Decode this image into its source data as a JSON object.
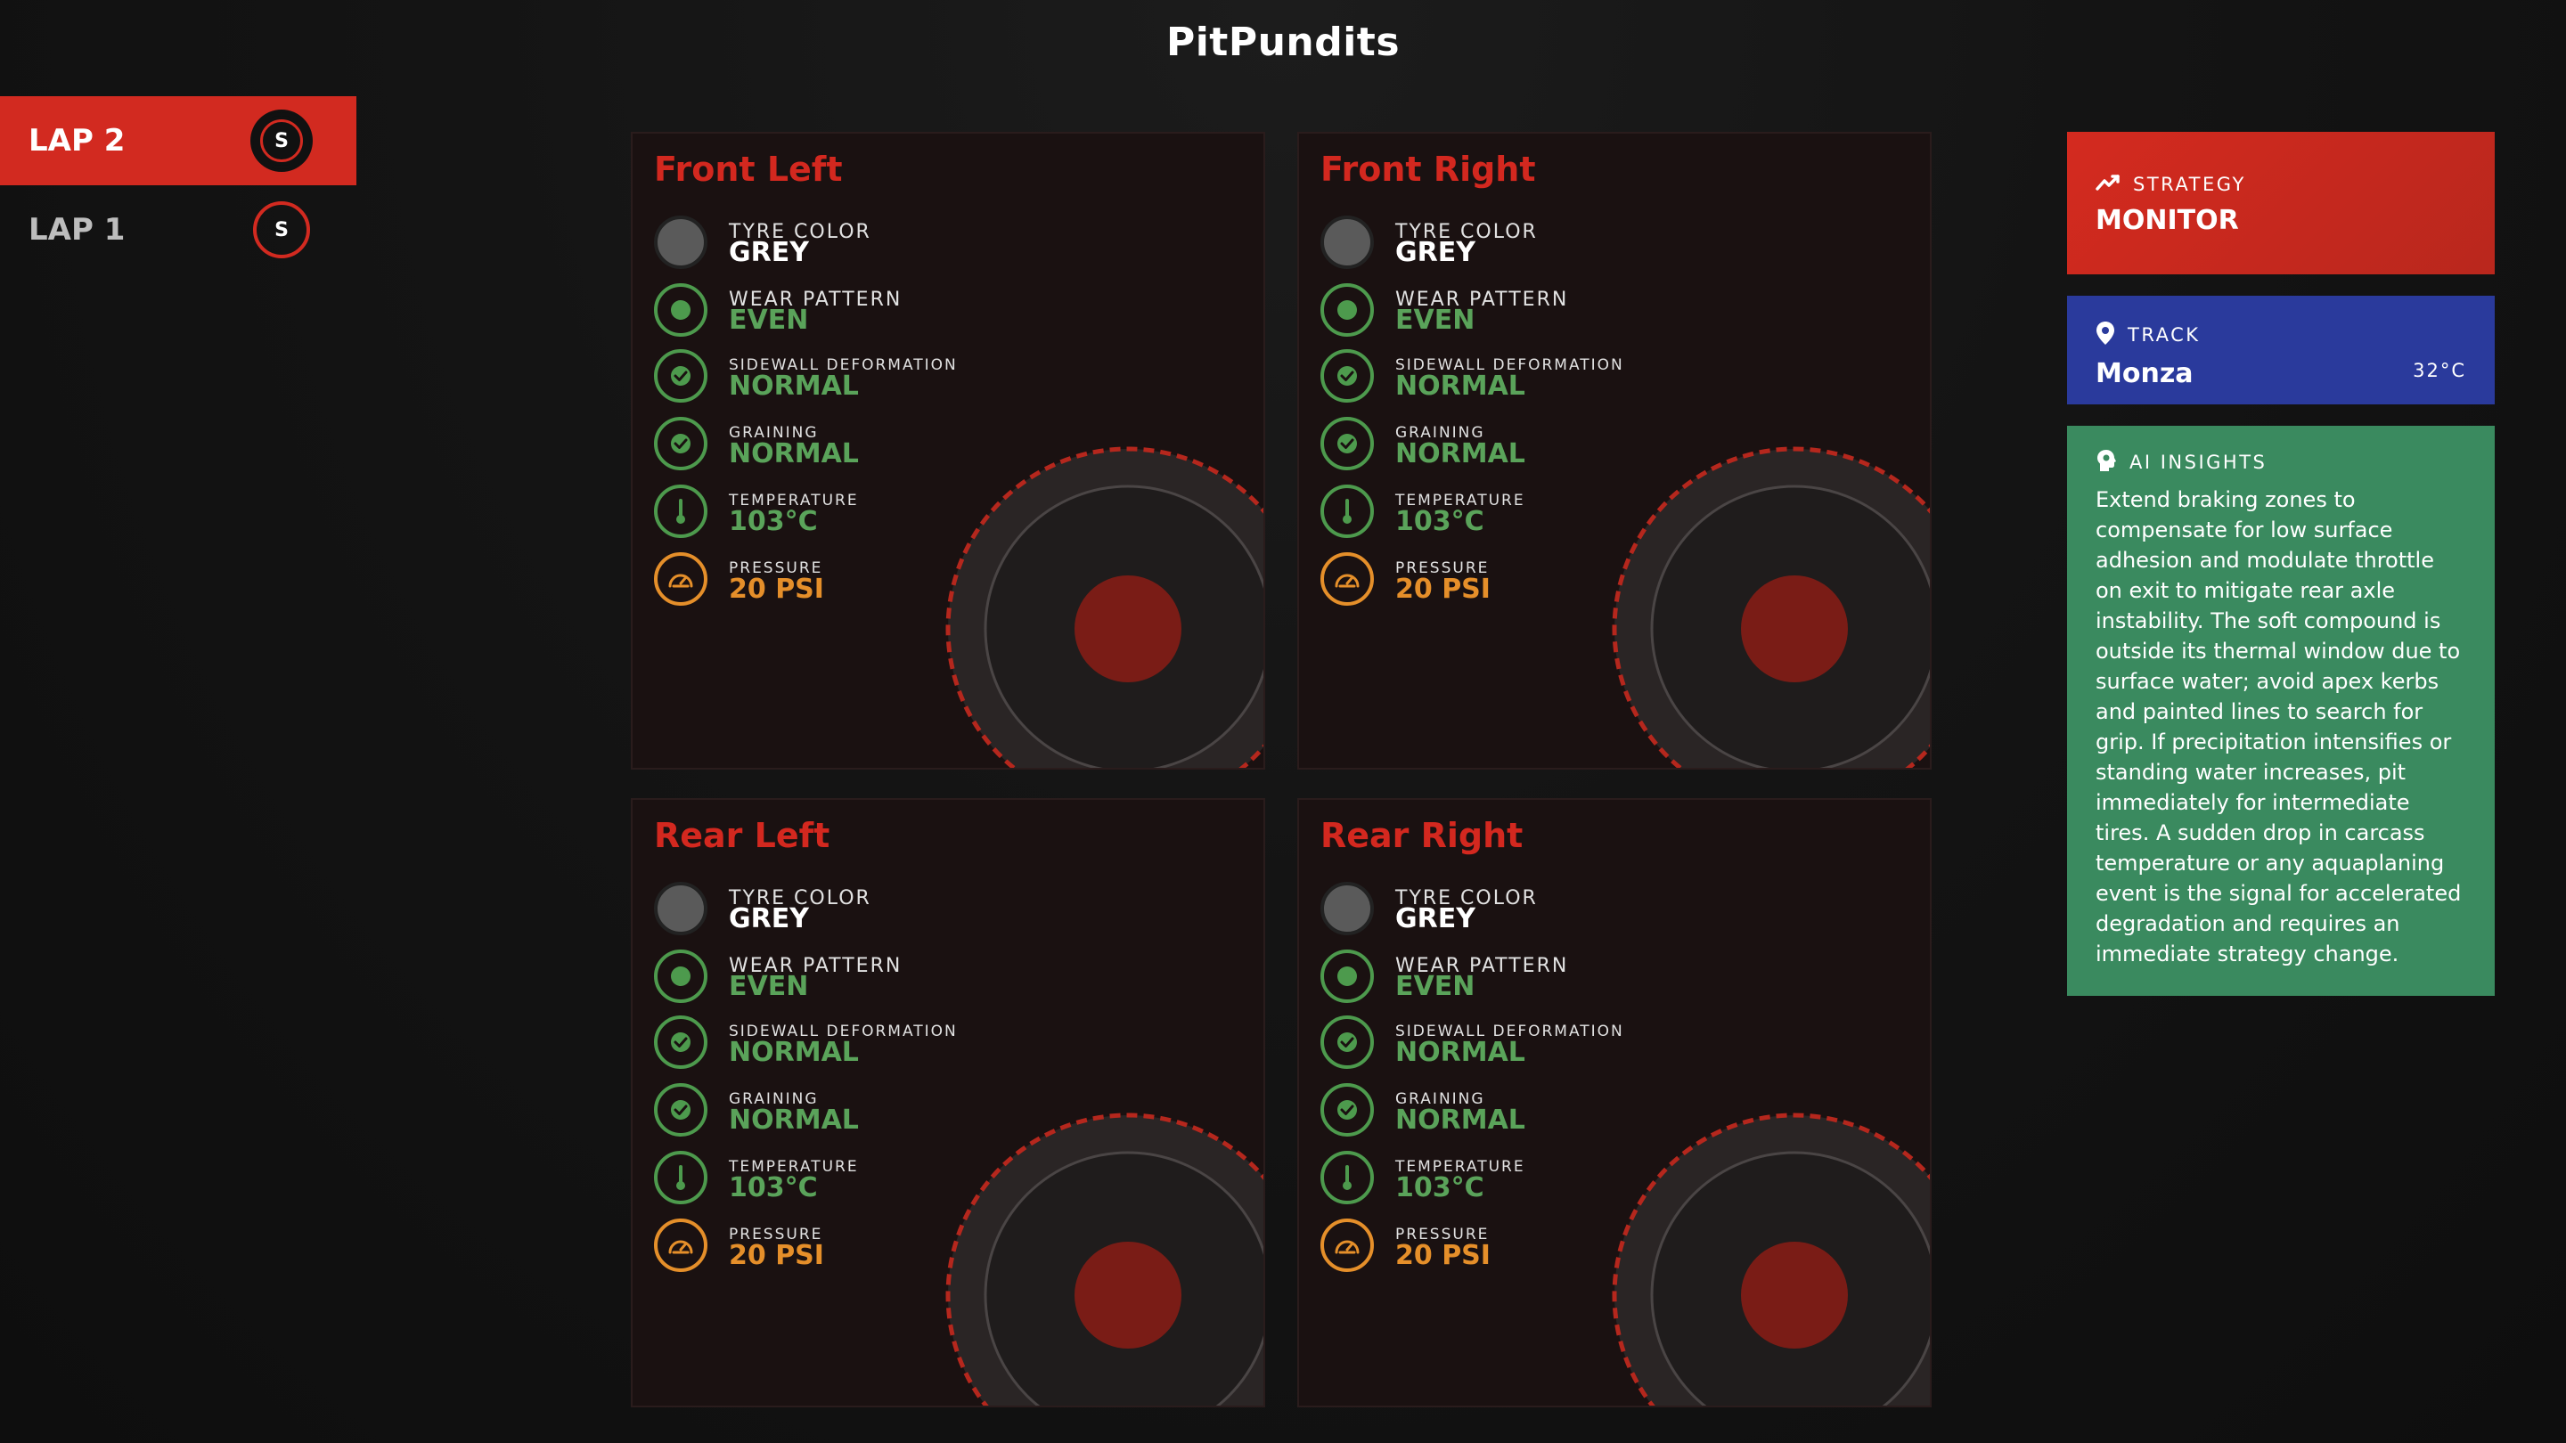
{
  "app": {
    "title": "PitPundits"
  },
  "laps": [
    {
      "label": "LAP 2",
      "badge": "S",
      "active": true
    },
    {
      "label": "LAP 1",
      "badge": "S",
      "active": false
    }
  ],
  "tyres": [
    {
      "name": "Front Left",
      "stats": [
        {
          "label": "TYRE COLOR",
          "value": "GREY",
          "icon": "grey-dot-icon"
        },
        {
          "label": "WEAR PATTERN",
          "value": "EVEN",
          "icon": "wear-dot-icon"
        },
        {
          "label": "SIDEWALL DEFORMATION",
          "value": "NORMAL",
          "icon": "check-circle-icon"
        },
        {
          "label": "GRAINING",
          "value": "NORMAL",
          "icon": "check-circle-icon"
        },
        {
          "label": "TEMPERATURE",
          "value": "103°C",
          "icon": "thermometer-icon"
        },
        {
          "label": "PRESSURE",
          "value": "20 PSI",
          "icon": "gauge-icon"
        }
      ]
    },
    {
      "name": "Front Right",
      "stats": [
        {
          "label": "TYRE COLOR",
          "value": "GREY",
          "icon": "grey-dot-icon"
        },
        {
          "label": "WEAR PATTERN",
          "value": "EVEN",
          "icon": "wear-dot-icon"
        },
        {
          "label": "SIDEWALL DEFORMATION",
          "value": "NORMAL",
          "icon": "check-circle-icon"
        },
        {
          "label": "GRAINING",
          "value": "NORMAL",
          "icon": "check-circle-icon"
        },
        {
          "label": "TEMPERATURE",
          "value": "103°C",
          "icon": "thermometer-icon"
        },
        {
          "label": "PRESSURE",
          "value": "20 PSI",
          "icon": "gauge-icon"
        }
      ]
    },
    {
      "name": "Rear Left",
      "stats": [
        {
          "label": "TYRE COLOR",
          "value": "GREY",
          "icon": "grey-dot-icon"
        },
        {
          "label": "WEAR PATTERN",
          "value": "EVEN",
          "icon": "wear-dot-icon"
        },
        {
          "label": "SIDEWALL DEFORMATION",
          "value": "NORMAL",
          "icon": "check-circle-icon"
        },
        {
          "label": "GRAINING",
          "value": "NORMAL",
          "icon": "check-circle-icon"
        },
        {
          "label": "TEMPERATURE",
          "value": "103°C",
          "icon": "thermometer-icon"
        },
        {
          "label": "PRESSURE",
          "value": "20 PSI",
          "icon": "gauge-icon"
        }
      ]
    },
    {
      "name": "Rear Right",
      "stats": [
        {
          "label": "TYRE COLOR",
          "value": "GREY",
          "icon": "grey-dot-icon"
        },
        {
          "label": "WEAR PATTERN",
          "value": "EVEN",
          "icon": "wear-dot-icon"
        },
        {
          "label": "SIDEWALL DEFORMATION",
          "value": "NORMAL",
          "icon": "check-circle-icon"
        },
        {
          "label": "GRAINING",
          "value": "NORMAL",
          "icon": "check-circle-icon"
        },
        {
          "label": "TEMPERATURE",
          "value": "103°C",
          "icon": "thermometer-icon"
        },
        {
          "label": "PRESSURE",
          "value": "20 PSI",
          "icon": "gauge-icon"
        }
      ]
    }
  ],
  "strategy": {
    "label": "STRATEGY",
    "value": "MONITOR",
    "icon": "trend-up-icon"
  },
  "track": {
    "label": "TRACK",
    "value": "Monza",
    "temperature": "32°C",
    "icon": "location-pin-icon"
  },
  "ai_insights": {
    "label": "AI INSIGHTS",
    "icon": "brain-head-icon",
    "text": "Extend braking zones to compensate for low surface adhesion and modulate throttle on exit to mitigate rear axle instability. The soft compound is outside its thermal window due to surface water; avoid apex kerbs and painted lines to search for grip. If precipitation intensifies or standing water increases, pit immediately for intermediate tires. A sudden drop in carcass temperature or any aquaplaning event is the signal for accelerated degradation and requires an immediate strategy change."
  },
  "colors": {
    "accent_red": "#d22a20",
    "track_blue": "#2a3a9c",
    "insight_green": "#3a8a5f",
    "status_green": "#5aa35a",
    "status_orange": "#e58f2a"
  }
}
